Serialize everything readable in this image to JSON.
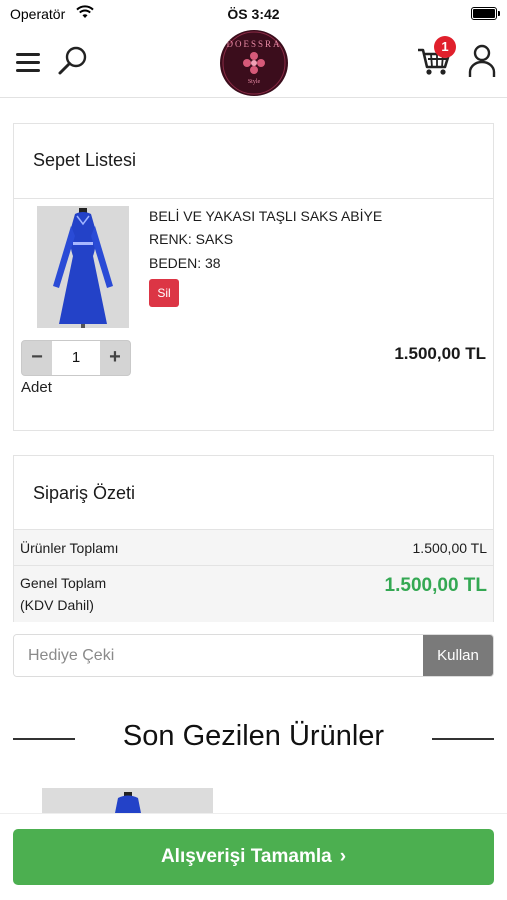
{
  "status_bar": {
    "carrier": "Operatör",
    "time": "ÖS 3:42"
  },
  "header": {
    "logo_text": "DOESSRA",
    "logo_sub": "Style",
    "cart_count": "1",
    "icons": [
      "menu-icon",
      "search-icon",
      "cart-icon",
      "user-icon"
    ]
  },
  "cart": {
    "title": "Sepet Listesi",
    "item": {
      "name": "BELİ VE YAKASI TAŞLI SAKS ABİYE",
      "color": "RENK: SAKS",
      "size": "BEDEN: 38",
      "delete_label": "Sil",
      "quantity": "1",
      "minus_label": "−",
      "plus_label": "+",
      "quantity_label": "Adet",
      "price": "1.500,00 TL"
    }
  },
  "summary": {
    "title": "Sipariş Özeti",
    "products_total_label": "Ürünler Toplamı",
    "products_total_value": "1.500,00 TL",
    "grand_total_label": "Genel Toplam",
    "grand_total_note": "(KDV Dahil)",
    "grand_total_value": "1.500,00 TL"
  },
  "coupon": {
    "placeholder": "Hediye Çeki",
    "button_label": "Kullan"
  },
  "recent": {
    "title": "Son Gezilen Ürünler"
  },
  "checkout": {
    "label": "Alışverişi Tamamla",
    "chevron": "›"
  },
  "colors": {
    "accent_green": "#4caf50",
    "total_green": "#34a853",
    "badge_red": "#e0202c",
    "delete_red": "#dc3545",
    "logo_bg": "#3b0d1c",
    "dress_blue": "#2342c8"
  }
}
